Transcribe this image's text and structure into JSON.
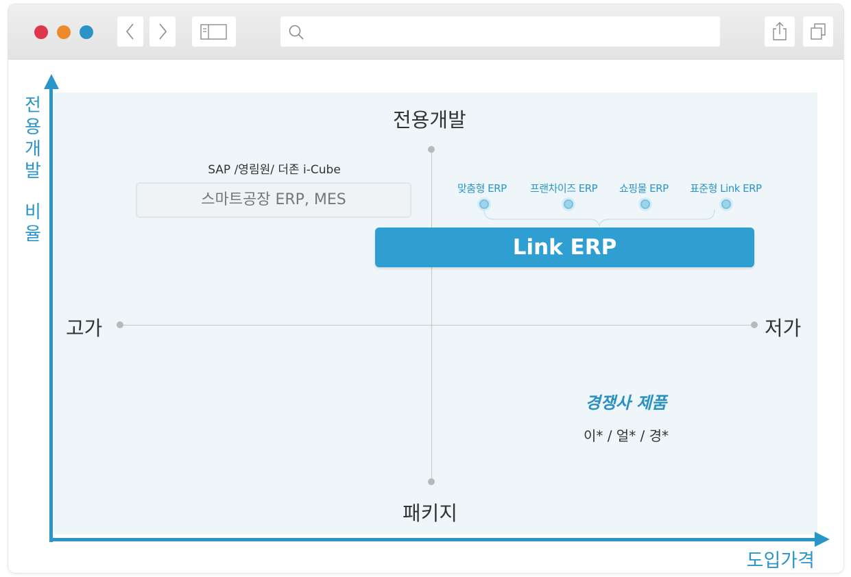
{
  "browser": {
    "traffic_lights": [
      "#e0364c",
      "#ec8a2c",
      "#2b93c6"
    ],
    "back_icon": "chevron-left-icon",
    "forward_icon": "chevron-right-icon",
    "sidebar_icon": "sidebar-icon",
    "search_icon": "search-icon",
    "share_icon": "share-icon",
    "tabs_icon": "tabs-icon"
  },
  "diagram": {
    "y_axis_label": [
      "전",
      "용",
      "개",
      "발",
      "",
      "비",
      "율"
    ],
    "x_axis_label": "도입가격",
    "top_label": "전용개발",
    "bottom_label": "패키지",
    "left_label": "고가",
    "right_label": "저가",
    "sap_caption": "SAP /영림원/ 더존 i-Cube",
    "sap_box_text": "스마트공장 ERP, MES",
    "products": [
      "맞춤형 ERP",
      "프랜차이즈 ERP",
      "쇼핑몰 ERP",
      "표준형 Link ERP"
    ],
    "link_erp": "Link ERP",
    "competitor_title": "경쟁사 제품",
    "competitor_list": "이* / 얼* / 경*",
    "accent_color": "#2a95c9",
    "bar_color": "#2f9ed0"
  }
}
